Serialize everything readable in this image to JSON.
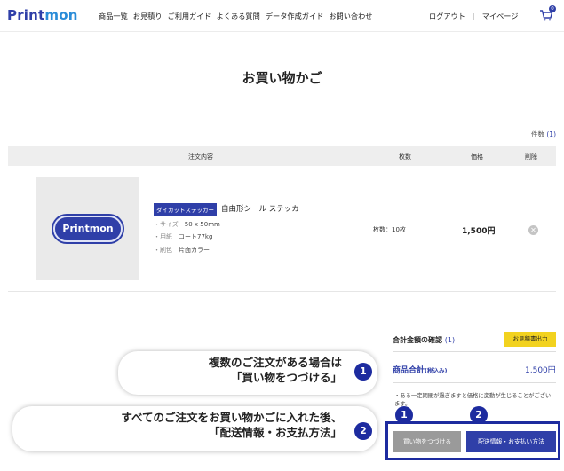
{
  "header": {
    "logo_a": "Print",
    "logo_b": "mon",
    "nav": [
      "商品一覧",
      "お見積り",
      "ご利用ガイド",
      "よくある質問",
      "データ作成ガイド",
      "お問い合わせ"
    ],
    "logout": "ログアウト",
    "separator": "|",
    "mypage": "マイページ",
    "cart_count": "0"
  },
  "page_title": "お買い物かご",
  "item_count": {
    "label": "件数",
    "value": "(1)"
  },
  "table": {
    "headers": [
      "注文内容",
      "枚数",
      "価格",
      "削除"
    ]
  },
  "item": {
    "thumbnail_text": "Printmon",
    "badge": "ダイカットステッカー",
    "name": "自由形シール ステッカー",
    "specs": [
      {
        "key": "・サイズ",
        "value": "50 x 50mm"
      },
      {
        "key": "・用紙",
        "value": "コート77kg"
      },
      {
        "key": "・刷色",
        "value": "片面カラー"
      }
    ],
    "quantity": "枚数：10枚",
    "price": "1,500円",
    "delete_glyph": "✕"
  },
  "summary": {
    "title": "合計金額の確認",
    "title_count": "(1)",
    "quote_button": "お見積書出力",
    "subtotal_label": "商品合計",
    "subtotal_tax": "(税込み)",
    "subtotal_value": "1,500円",
    "notice": "・ある一定期間が過ぎますと価格に変動が生じることがございます。"
  },
  "buttons": {
    "continue": "買い物をつづける",
    "checkout": "配送情報・お支払い方法"
  },
  "callouts": {
    "one_line1": "複数のご注文がある場合は",
    "one_line2": "「買い物をつづける」",
    "two_line1": "すべてのご注文をお買い物かごに入れた後、",
    "two_line2": "「配送情報・お支払方法」",
    "num1": "1",
    "num2": "2"
  },
  "colors": {
    "brand": "#2f3fa8",
    "accent_yellow": "#f2d21f",
    "callout_blue": "#1d2b9f"
  }
}
